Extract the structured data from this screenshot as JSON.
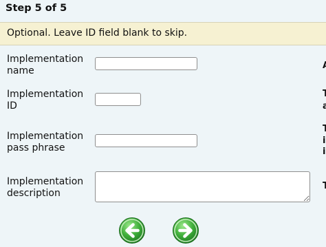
{
  "header": {
    "step_label": "Step 5 of 5"
  },
  "notice": {
    "text": "Optional. Leave ID field blank to skip."
  },
  "form": {
    "name_label": "Implementation name",
    "name_value": "",
    "id_label": "Implementation ID",
    "id_value": "",
    "passphrase_label": "Implementation pass phrase",
    "passphrase_value": "",
    "description_label": "Implementation description",
    "description_value": ""
  },
  "help_column": {
    "marks": [
      "A",
      "T",
      "a",
      "T",
      "i",
      "i",
      "T"
    ]
  },
  "navigation": {
    "back_icon": "left-arrow-icon",
    "next_icon": "right-arrow-icon"
  },
  "colors": {
    "background": "#eef5f8",
    "notice_background": "#f6f1d2",
    "nav_button_green": "#3fae3a"
  }
}
